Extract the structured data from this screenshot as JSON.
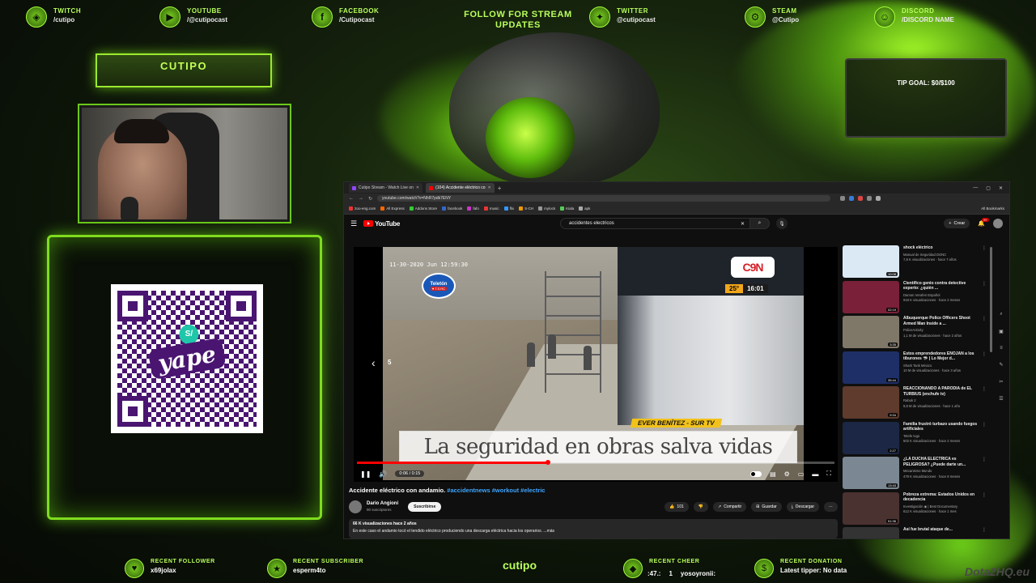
{
  "overlay": {
    "socials": [
      {
        "name": "TWITCH",
        "handle": "/cutipo",
        "icon": "twitch-icon",
        "glyph": "◈"
      },
      {
        "name": "YOUTUBE",
        "handle": "/@cutipocast",
        "icon": "youtube-icon",
        "glyph": "▶"
      },
      {
        "name": "FACEBOOK",
        "handle": "/Cutipocast",
        "icon": "facebook-icon",
        "glyph": "f"
      },
      {
        "name": "TWITTER",
        "handle": "@cutipocast",
        "icon": "twitter-icon",
        "glyph": "✦"
      },
      {
        "name": "STEAM",
        "handle": "@Cutipo",
        "icon": "steam-icon",
        "glyph": "⚙"
      },
      {
        "name": "DISCORD",
        "handle": "/DISCORD NAME",
        "icon": "discord-icon",
        "glyph": "☺"
      }
    ],
    "follow_text": "FOLLOW FOR STREAM UPDATES",
    "streamer_name": "CUTIPO",
    "tip_goal": "TIP GOAL: $0/$100",
    "qr_brand": "yape",
    "qr_coin": "S/",
    "bottom": {
      "recent_follower_label": "RECENT FOLLOWER",
      "recent_follower": "x69jolax",
      "recent_subscriber_label": "RECENT SUBSCRIBER",
      "recent_subscriber": "esperm4to",
      "brand": "cutipo",
      "recent_cheer_label": "RECENT CHEER",
      "recent_cheer_a": ":47.:",
      "recent_cheer_b": "1",
      "recent_cheer_c": "yosoyronii:",
      "recent_donation_label": "RECENT DONATION",
      "recent_donation": "Latest tipper: No data",
      "watermark": "Dota2HQ.eu"
    },
    "colors": {
      "accent": "#9be92e",
      "bg": "#0b1208"
    }
  },
  "browser": {
    "tabs": [
      {
        "label": "Cutipo Stream - Watch Live on",
        "favicon": "#9146ff",
        "active": false
      },
      {
        "label": "(104) Accidente eléctrico co",
        "favicon": "#ff0000",
        "active": true
      }
    ],
    "url": "youtube.com/watch?v=NhR7pdk7ENY",
    "bookmarks": [
      "2oo-eng.com",
      "All Express",
      "Addons Store",
      "facebook",
      "fafo",
      "music",
      "flix",
      "S-CH",
      "mylock",
      "Kiala",
      "apk"
    ],
    "all_bookmarks": "All Bookmarks"
  },
  "youtube": {
    "logo": "YouTube",
    "search_value": "accidentes electricos",
    "crear": "Crear",
    "notif_count": "9+",
    "video": {
      "timestamp": "11-30-2020 Jun 12:59:30",
      "teleton": "Teletón",
      "teleton_sub": "♥ T.S.RC",
      "channel_logo": "C9N",
      "temp": "25°",
      "clock": "16:01",
      "credit": "EVER BENÍTEZ - SUR TV",
      "caption": "La seguridad en obras salva vidas",
      "seek_num": "5",
      "time": "0:06 / 0:15",
      "progress": 0.4
    },
    "title_main": "Accidente eléctrico con andamio.",
    "title_tags": "#accidentnews #workout #electric",
    "channel": "Dario Angioni",
    "channel_subs": "90 suscriptores",
    "subscribe": "Suscribirse",
    "likes": "101",
    "share": "Compartir",
    "save": "Guardar",
    "download": "Descargar",
    "views": "66 K visualizaciones  hace 2 años",
    "description": "En este caso el andamio tocó el tendido eléctrico produciendo una descarga eléctrica hacia los operarios.  ...más",
    "recs": [
      {
        "title": "shock eléctrico",
        "channel": "Manual de Seguridad DONC",
        "meta": "7,8 K visualizaciones · hace 7 años",
        "dur": "10:08",
        "bg": "#dbe9f5"
      },
      {
        "title": "Científico genio contra detective experto: ¿quién ...",
        "channel": "Damon Verafen Español",
        "meta": "918 K visualizaciones · hace 2 meses",
        "dur": "02:19",
        "bg": "#7a2038"
      },
      {
        "title": "Albuquerque Police Officers Shoot Armed Man Inside a ...",
        "channel": "PoliceActivity",
        "meta": "1,1 M de visualizaciones · hace 2 años",
        "dur": "3:35",
        "bg": "#7f7869"
      },
      {
        "title": "Estos emprendedores ENOJAN a los tiburones 🦈 | Lo Mejor d...",
        "channel": "Shark Tank México",
        "meta": "10 M de visualizaciones · hace 3 años",
        "dur": "35:44",
        "bg": "#1d2f66"
      },
      {
        "title": "REACCIONANDO A PARODIA de EL TURBIUS (enchufe tv)",
        "channel": "Rabuk 2",
        "meta": "9,8 M de visualizaciones · hace 1 año",
        "dur": "9:34",
        "bg": "#5e3b2d"
      },
      {
        "title": "Familia frustró turbazo usando fuegos artificiales",
        "channel": "Telefe tvgo",
        "meta": "502 K visualizaciones · hace 2 meses",
        "dur": "2:27",
        "bg": "#1b2744"
      },
      {
        "title": "¿LA DUCHA ELÉCTRICA es PELIGROSA? ¿Puede darte un...",
        "channel": "Mecanismo Mundo",
        "meta": "479 K visualizaciones · hace 8 meses",
        "dur": "13:43",
        "bg": "#7b8792"
      },
      {
        "title": "Pobreza extrema: Estados Unidos en decadencia",
        "channel": "Investigación ◉ | Best Documentary",
        "meta": "612 K visualizaciones · hace 1 mes",
        "dur": "51:36",
        "bg": "#4a3231"
      },
      {
        "title": "Así fue brutal ataque de...",
        "channel": "",
        "meta": "",
        "dur": "",
        "bg": "#333"
      }
    ]
  }
}
